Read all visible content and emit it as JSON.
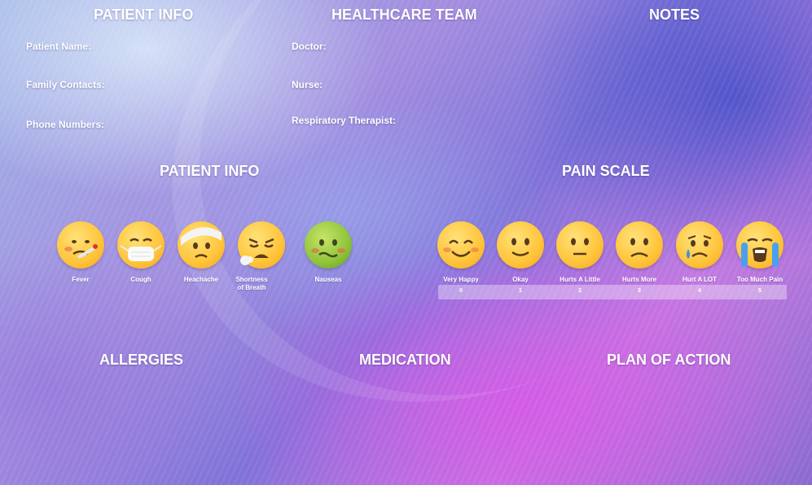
{
  "headers": {
    "patient_info_top": "PATIENT INFO",
    "healthcare_team": "HEALTHCARE TEAM",
    "notes": "NOTES",
    "patient_info_mid": "PATIENT INFO",
    "pain_scale": "PAIN SCALE",
    "allergies": "ALLERGIES",
    "medication": "MEDICATION",
    "plan_of_action": "PLAN OF ACTION"
  },
  "patient_fields": [
    "Patient Name:",
    "Family Contacts:",
    "Phone Numbers:"
  ],
  "team_fields": [
    "Doctor:",
    "Nurse:",
    "Respiratory Therapist:"
  ],
  "symptoms": [
    {
      "label": "Fever",
      "icon": "fever-face-icon"
    },
    {
      "label": "Cough",
      "icon": "mask-face-icon"
    },
    {
      "label": "Heachache",
      "icon": "bandaged-head-face-icon"
    },
    {
      "label": "Shortness of Breath",
      "icon": "exhaling-face-icon"
    },
    {
      "label": "Nauseas",
      "icon": "nauseated-face-icon"
    }
  ],
  "pain_scale": [
    {
      "label": "Very Happy",
      "value": "0",
      "icon": "smiling-face-icon"
    },
    {
      "label": "Okay",
      "value": "1",
      "icon": "slight-smile-face-icon"
    },
    {
      "label": "Hurts A Little",
      "value": "2",
      "icon": "neutral-face-icon"
    },
    {
      "label": "Hurts More",
      "value": "3",
      "icon": "frowning-face-icon"
    },
    {
      "label": "Hurt A LOT",
      "value": "4",
      "icon": "crying-face-icon"
    },
    {
      "label": "Too Much Pain",
      "value": "5",
      "icon": "loudly-crying-face-icon"
    }
  ],
  "colors": {
    "text": "#ffffff",
    "emoji_yellow": "#ffc43a",
    "emoji_green": "#8fc43a"
  }
}
